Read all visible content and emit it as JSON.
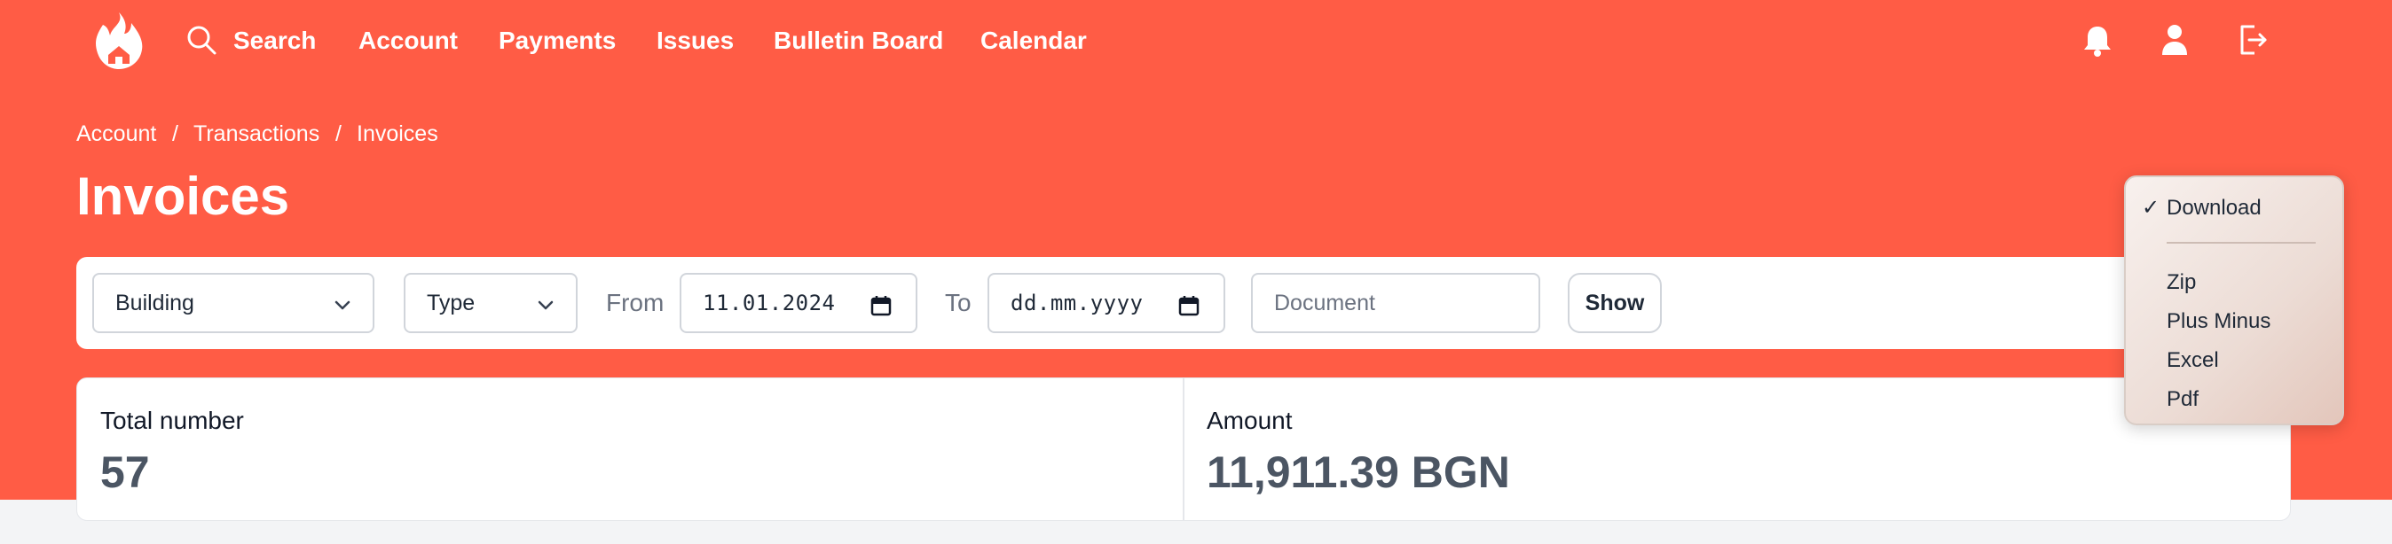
{
  "nav": {
    "links": [
      "Search",
      "Account",
      "Payments",
      "Issues",
      "Bulletin Board",
      "Calendar"
    ],
    "icons": [
      "bell-icon",
      "user-icon",
      "logout-icon"
    ]
  },
  "breadcrumb": [
    "Account",
    "/",
    "Transactions",
    "/",
    "Invoices"
  ],
  "page_title": "Invoices",
  "filters": {
    "building": "Building",
    "type": "Type",
    "from_label": "From",
    "from_value": "11.01.2024",
    "to_label": "To",
    "to_value": "dd.mm.yyyy",
    "document_placeholder": "Document",
    "show_label": "Show"
  },
  "stats": {
    "total_label": "Total number",
    "total_value": "57",
    "amount_label": "Amount",
    "amount_value": "11,911.39 BGN"
  },
  "menu": {
    "checked_item": "Download",
    "check_mark": "✓",
    "items": [
      "Zip",
      "Plus Minus",
      "Excel",
      "Pdf"
    ]
  },
  "colors": {
    "brand": "#ff5c45",
    "page_bg": "#f3f4f6"
  }
}
